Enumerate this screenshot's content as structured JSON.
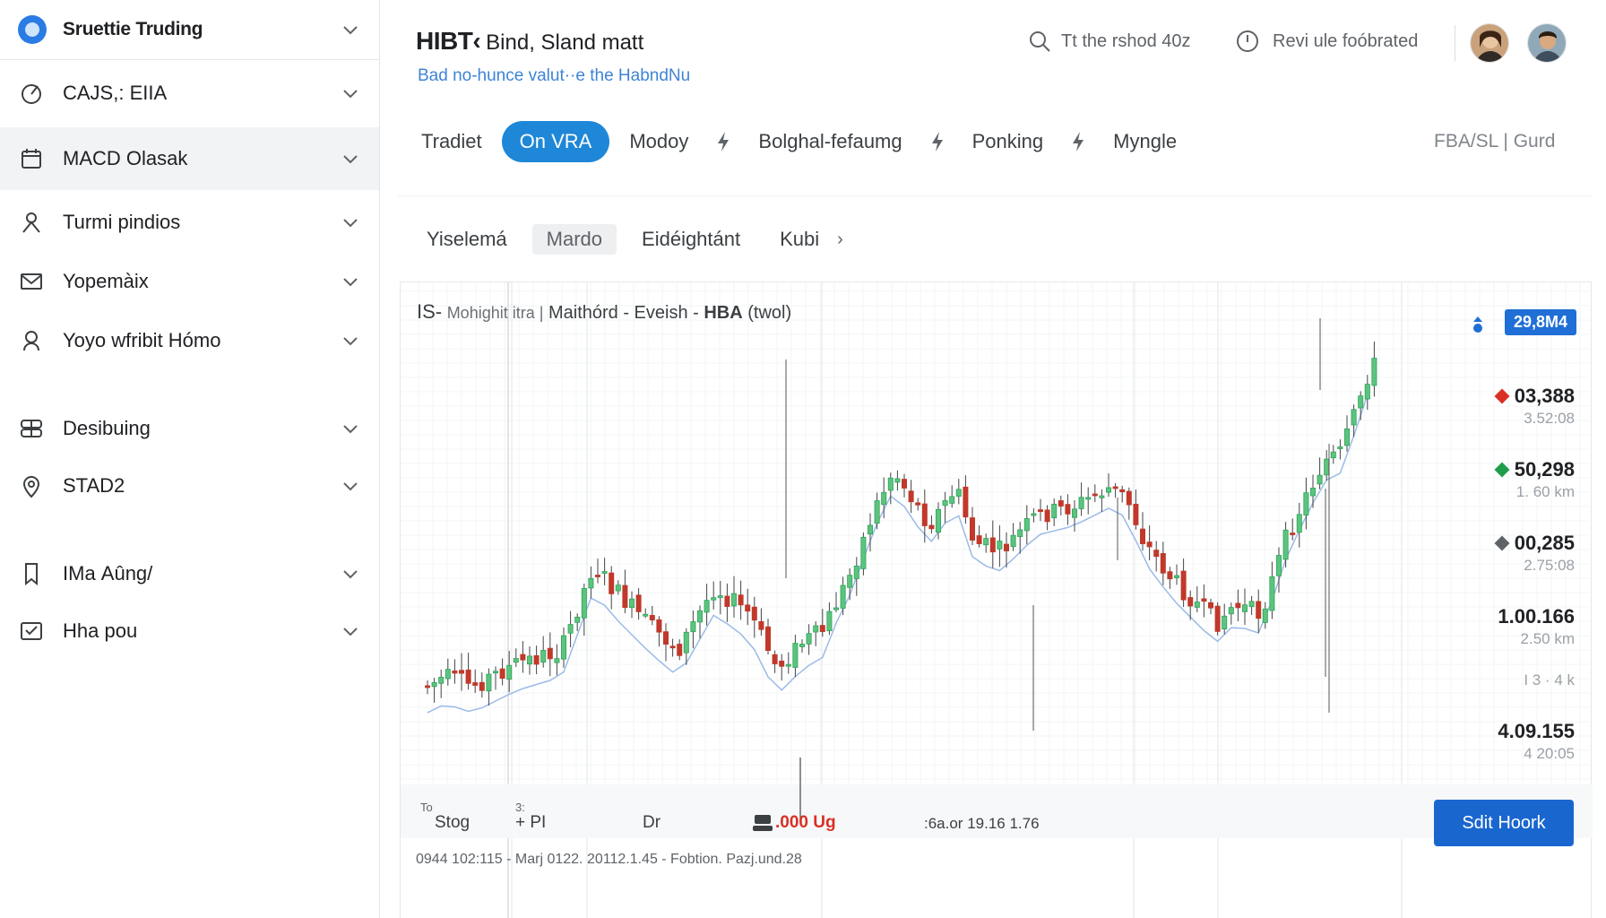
{
  "sidebar": {
    "header": {
      "title": "Sruettie Truding"
    },
    "items": [
      {
        "label": "CAJS,: EIIA",
        "icon": "gauge-icon"
      },
      {
        "label": "MACD Olasak",
        "icon": "calendar-icon",
        "active": true
      },
      {
        "label": "Turmi pindios",
        "icon": "person-icon"
      },
      {
        "label": "Yopemàix",
        "icon": "mail-icon"
      },
      {
        "label": "Yoyo wfribit Hómo",
        "icon": "user-badge-icon"
      },
      {
        "label": "Desibuing",
        "icon": "grid-icon"
      },
      {
        "label": "STAD2",
        "icon": "location-pin-icon"
      },
      {
        "label": "IMа Aûng/",
        "icon": "bookmark-icon"
      },
      {
        "label": "Hha pou",
        "icon": "inbox-icon"
      }
    ]
  },
  "header": {
    "title_strong": "HIBT‹",
    "title_rest": "Bind, Sland matt",
    "subtitle": "Bad no-hunce valut··e the HabndNu",
    "search_text": "Tt the rshod 40z",
    "review_text": "Revi ule foóbrated"
  },
  "tabs": {
    "items": [
      "Tradiet",
      "On VRA",
      "Modoy",
      "Bolghal-fefaumg",
      "Ponking",
      "Myngle"
    ],
    "active_index": 1,
    "right_text": "FBA/SL | Gurd"
  },
  "subtabs": {
    "items": [
      "Yiselemá",
      "Mardo",
      "Eidéightánt",
      "Kubi"
    ],
    "active_index": 1,
    "more": "›"
  },
  "chart": {
    "title_prefix": "IS-",
    "title_light": "Mohighit itra |",
    "title_main": "Maithórd - Eveish - ",
    "title_bold": "HBA",
    "title_suffix": " (twol)",
    "badge": "29,8M4",
    "levels": [
      {
        "value": "03,388",
        "sub": "3.52:08",
        "marker": "#d93025"
      },
      {
        "value": "50,298",
        "sub": "1. 60 km",
        "marker": "#1e9e4a"
      },
      {
        "value": "00,285",
        "sub": "2.75:08",
        "marker": "#5f6368"
      },
      {
        "value": "1.00.166",
        "sub": "2.50 km",
        "marker": ""
      },
      {
        "value": "",
        "sub": "I 3 · 4 k",
        "marker": ""
      },
      {
        "value": "4.09.155",
        "sub": "4 20:05",
        "marker": ""
      }
    ],
    "bottom": {
      "stog_tiny": "To",
      "stog": "Stog",
      "pi_tiny": "3:",
      "pi": "+ PI",
      "dr": "Dr",
      "ug": ".000 Ug",
      "fbor": ":6a.or 19.16 1.76"
    },
    "footer": "0944 102:115 - Marj 0122. 20112.1.45 - Fobtion. Pazj.und.28",
    "edit_button": "Sdit Hoork"
  },
  "colors": {
    "accent": "#1f87d8",
    "up": "#1e9e4a",
    "down": "#c0392b",
    "ma": "#9bbbe8"
  },
  "chart_data": {
    "type": "candlestick",
    "title": "Maithórd - Eveish - HBA (twol)",
    "y_levels": [
      "03,388",
      "50,298",
      "00,285",
      "1.00.166",
      "4.09.155"
    ],
    "candles_count": 140,
    "trend": "rising with dip at middle, sharp rally at end",
    "ma_line": true,
    "grid": true
  }
}
